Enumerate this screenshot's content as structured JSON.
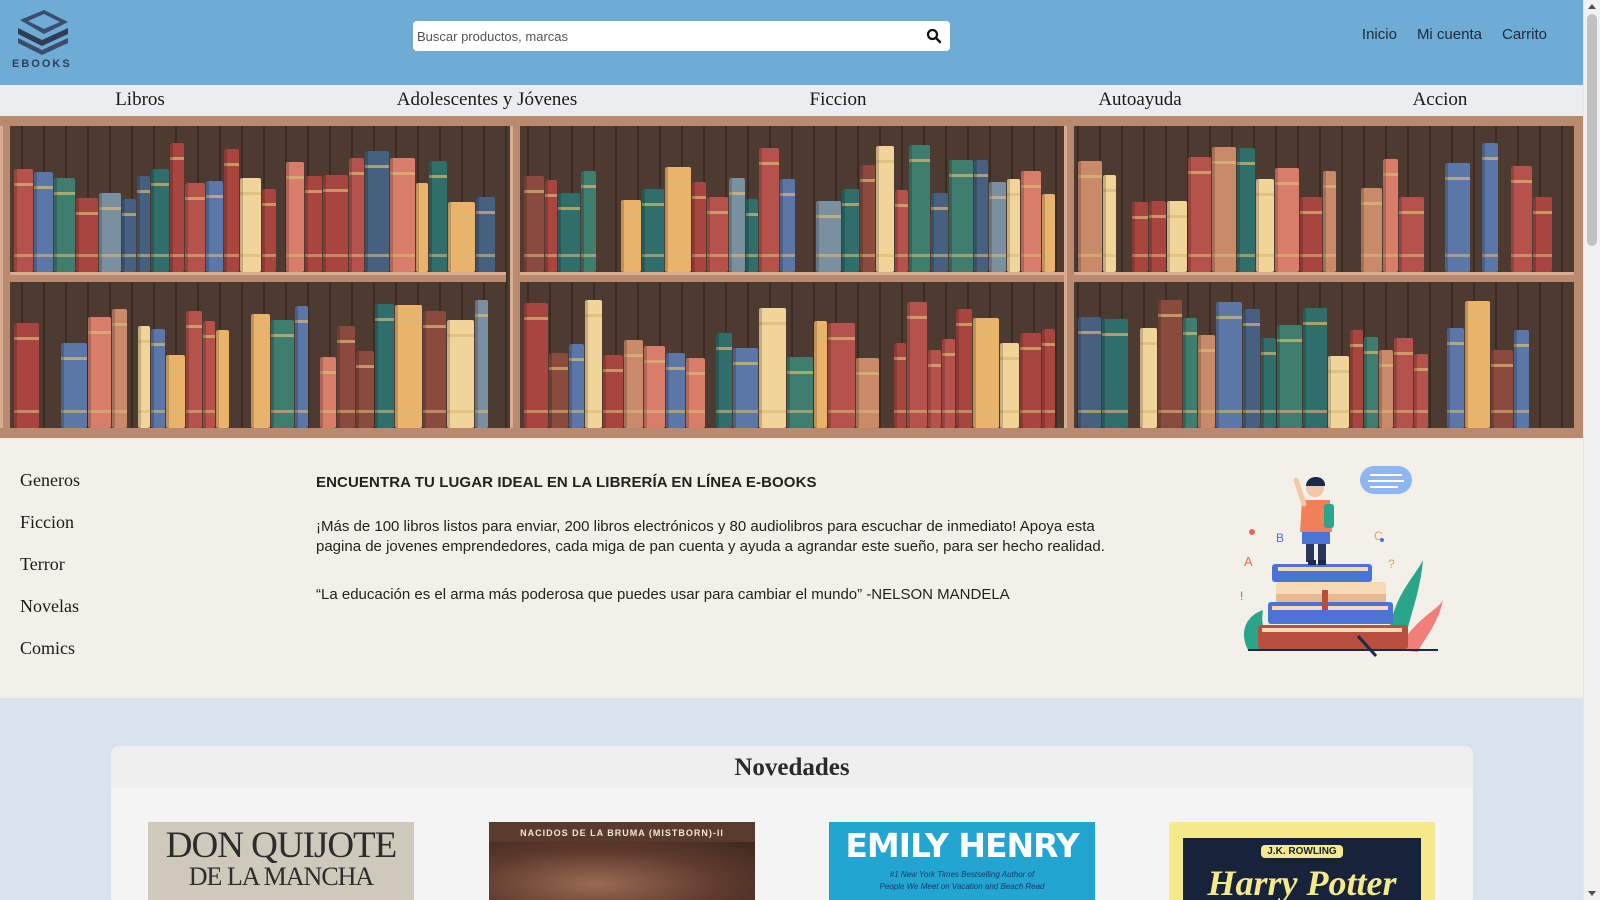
{
  "brand": {
    "name": "EBOOKS"
  },
  "search": {
    "placeholder": "Buscar productos, marcas"
  },
  "top_links": [
    "Inicio",
    "Mi cuenta",
    "Carrito"
  ],
  "categories": [
    "Libros",
    "Adolescentes y Jóvenes",
    "Ficcion",
    "Autoayuda",
    "Accion"
  ],
  "genres": {
    "items": [
      "Generos",
      "Ficcion",
      "Terror",
      "Novelas",
      "Comics"
    ]
  },
  "intro": {
    "heading": "ENCUENTRA TU LUGAR IDEAL EN LA LIBRERÍA EN LÍNEA E-BOOKS",
    "paragraph": "¡Más de 100 libros listos para enviar, 200 libros electrónicos y 80 audiolibros para escuchar de inmediato! Apoya esta pagina de jovenes emprendedores, cada miga de pan cuenta y ayuda a agrandar este sueño, para ser hecho realidad.",
    "quote": "“La educación es el arma más poderosa que puedes usar para cambiar el mundo” -NELSON MANDELA"
  },
  "novedades": {
    "title": "Novedades",
    "books": [
      {
        "line1": "DON QUIJOTE",
        "line2": "DE LA MANCHA"
      },
      {
        "line1": "NACIDOS DE LA BRUMA (MISTBORN)-II"
      },
      {
        "line1": "EMILY HENRY",
        "line2": "#1 New York Times Bestselling Author of",
        "line3": "People We Meet on Vacation and Beach Read"
      },
      {
        "line1": "J.K. ROWLING",
        "line2": "Harry Potter"
      }
    ]
  },
  "colors": {
    "header_bg": "#6eabd5",
    "nav_bg": "#ecedee",
    "page_bg": "#f3f0ea",
    "novedades_bg": "#d8e3ed"
  }
}
